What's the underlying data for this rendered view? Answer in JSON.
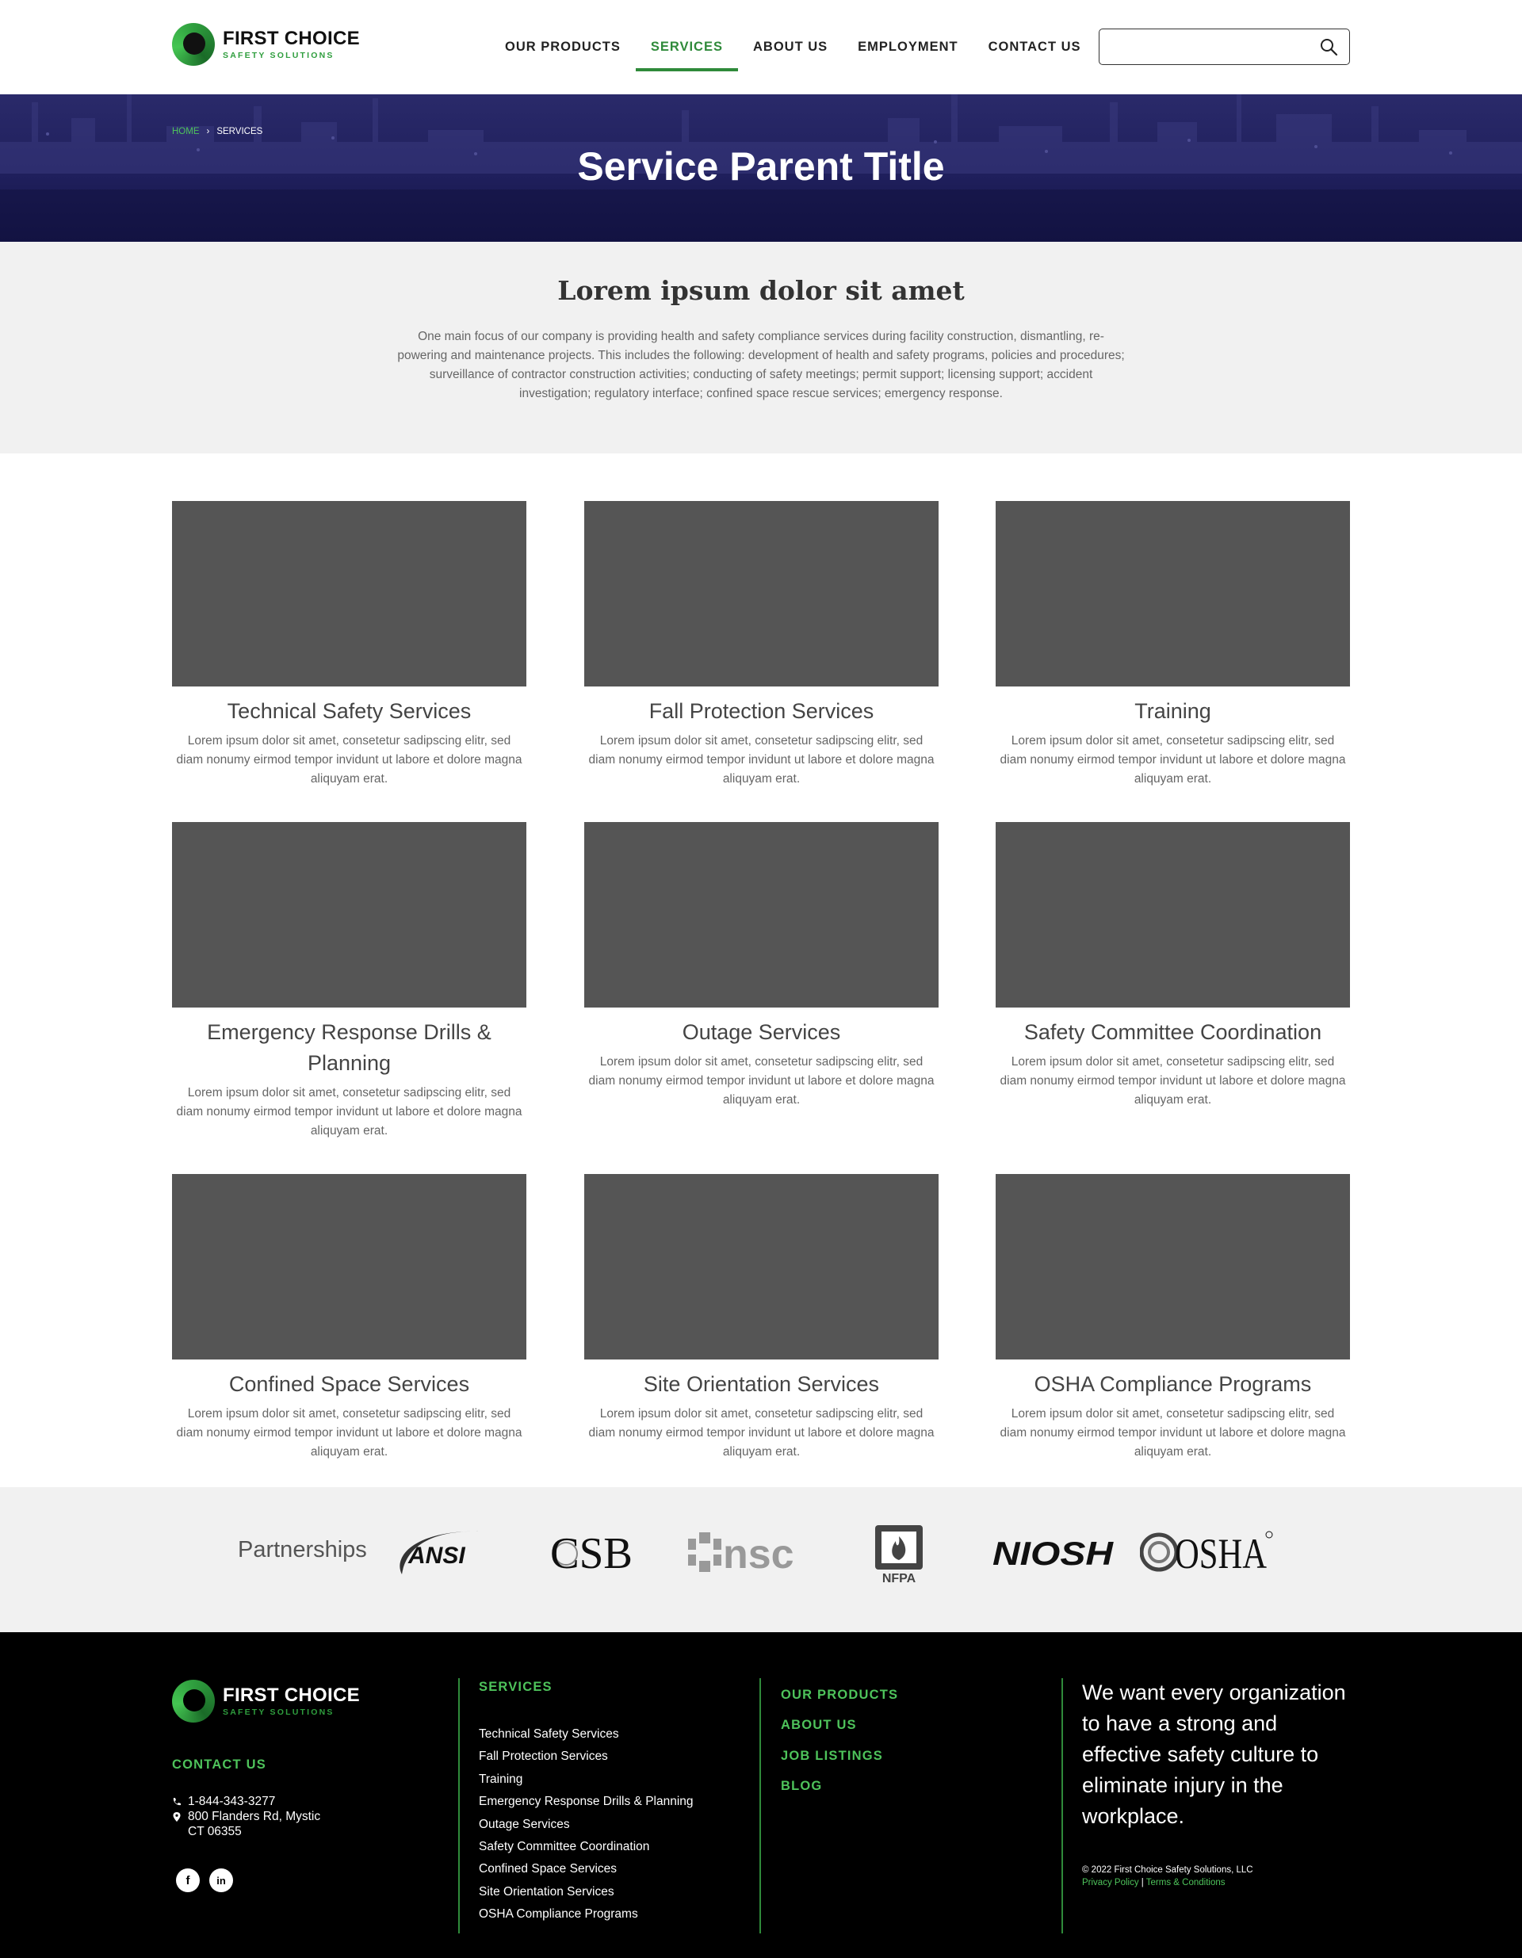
{
  "header": {
    "logo": {
      "title": "FIRST CHOICE",
      "subtitle": "SAFETY SOLUTIONS"
    },
    "nav": [
      {
        "label": "OUR PRODUCTS",
        "active": false
      },
      {
        "label": "SERVICES",
        "active": true
      },
      {
        "label": "ABOUT US",
        "active": false
      },
      {
        "label": "EMPLOYMENT",
        "active": false
      },
      {
        "label": "CONTACT US",
        "active": false
      }
    ],
    "search": {
      "placeholder": "",
      "icon": "search-icon"
    }
  },
  "hero": {
    "breadcrumb": {
      "home": "HOME",
      "separator": "›",
      "current": "SERVICES"
    },
    "title": "Service Parent Title"
  },
  "intro": {
    "title": "Lorem ipsum dolor sit amet",
    "body": "One main focus of our company is providing health and safety compliance services during facility construction, dismantling, re-powering and maintenance projects. This includes the following: development of health and safety programs, policies and procedures; surveillance of contractor construction activities; conducting of safety meetings; permit support; licensing support; accident investigation; regulatory interface; confined space rescue services; emergency response."
  },
  "services": [
    {
      "title": "Technical Safety Services",
      "text": "Lorem ipsum dolor sit amet, consetetur sadipscing elitr, sed diam nonumy eirmod tempor invidunt ut labore et dolore magna aliquyam erat."
    },
    {
      "title": "Fall Protection Services",
      "text": "Lorem ipsum dolor sit amet, consetetur sadipscing elitr, sed diam nonumy eirmod tempor invidunt ut labore et dolore magna aliquyam erat."
    },
    {
      "title": "Training",
      "text": "Lorem ipsum dolor sit amet, consetetur sadipscing elitr, sed diam nonumy eirmod tempor invidunt ut labore et dolore magna aliquyam erat."
    },
    {
      "title": "Emergency Response Drills & Planning",
      "text": "Lorem ipsum dolor sit amet, consetetur sadipscing elitr, sed diam nonumy eirmod tempor invidunt ut labore et dolore magna aliquyam erat."
    },
    {
      "title": "Outage Services",
      "text": "Lorem ipsum dolor sit amet, consetetur sadipscing elitr, sed diam nonumy eirmod tempor invidunt ut labore et dolore magna aliquyam erat."
    },
    {
      "title": "Safety Committee Coordination",
      "text": "Lorem ipsum dolor sit amet, consetetur sadipscing elitr, sed diam nonumy eirmod tempor invidunt ut labore et dolore magna aliquyam erat."
    },
    {
      "title": "Confined Space Services",
      "text": "Lorem ipsum dolor sit amet, consetetur sadipscing elitr, sed diam nonumy eirmod tempor invidunt ut labore et dolore magna aliquyam erat."
    },
    {
      "title": "Site Orientation Services",
      "text": "Lorem ipsum dolor sit amet, consetetur sadipscing elitr, sed diam nonumy eirmod tempor invidunt ut labore et dolore magna aliquyam erat."
    },
    {
      "title": "OSHA Compliance Programs",
      "text": "Lorem ipsum dolor sit amet, consetetur sadipscing elitr, sed diam nonumy eirmod tempor invidunt ut labore et dolore magna aliquyam erat."
    }
  ],
  "partnerships": {
    "label": "Partnerships",
    "logos": [
      "ANSI",
      "CSB",
      "nsc",
      "NFPA",
      "NIOSH",
      "OSHA"
    ]
  },
  "footer": {
    "logo": {
      "title": "FIRST CHOICE",
      "subtitle": "SAFETY SOLUTIONS"
    },
    "contact_heading": "CONTACT US",
    "phone": "1-844-343-3277",
    "address_line1": "800 Flanders Rd, Mystic",
    "address_line2": "CT 06355",
    "social": [
      {
        "icon": "facebook-icon",
        "glyph": "f"
      },
      {
        "icon": "linkedin-icon",
        "glyph": "in"
      }
    ],
    "services_heading": "SERVICES",
    "services_links": [
      "Technical Safety Services",
      "Fall Protection Services",
      "Training",
      "Emergency Response Drills & Planning",
      "Outage Services",
      "Safety Committee Coordination",
      "Confined Space Services",
      "Site Orientation Services",
      "OSHA Compliance Programs"
    ],
    "col3_links": [
      "OUR PRODUCTS",
      "ABOUT US",
      "JOB LISTINGS",
      "BLOG"
    ],
    "quote": "We want every organization to have a strong and effective safety culture to eliminate injury in the workplace.",
    "copyright": "© 2022 First Choice Safety Solutions, LLC",
    "privacy": "Privacy Policy",
    "separator": "|",
    "terms": "Terms & Conditions"
  },
  "colors": {
    "brand_green": "#2f8a3a",
    "accent_green": "#4ec35b",
    "hero_navy": "#1f1f5c",
    "placeholder_gray": "#555555"
  }
}
